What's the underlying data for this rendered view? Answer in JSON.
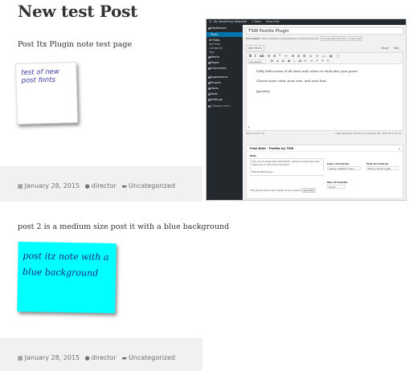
{
  "post1": {
    "title": "New test Post",
    "text": "Post Itx Plugin note test page",
    "note_text": "test of new post fonts",
    "meta": {
      "date": "January 28, 2015",
      "author": "director",
      "category": "Uncategorized"
    }
  },
  "post2": {
    "text": "post 2 is a medium size post it with a blue background",
    "note_text": "post itz note with a blue background",
    "note_color": "#00ffff",
    "meta": {
      "date": "January 28, 2015",
      "author": "director",
      "category": "Uncategorized"
    }
  },
  "wp_screenshot": {
    "adminbar": [
      "My WordPress Website",
      "0",
      "+ New",
      "View Post"
    ],
    "sidebar": {
      "items": [
        {
          "label": "Dashboard",
          "icon": "dashboard-icon"
        },
        {
          "label": "Posts",
          "icon": "posts-icon",
          "active": true
        },
        {
          "label": "Media",
          "icon": "media-icon"
        },
        {
          "label": "Pages",
          "icon": "pages-icon"
        },
        {
          "label": "Comments",
          "icon": "comments-icon"
        },
        {
          "label": "Appearance",
          "icon": "appearance-icon"
        },
        {
          "label": "Plugins",
          "icon": "plugins-icon"
        },
        {
          "label": "Users",
          "icon": "users-icon"
        },
        {
          "label": "Tools",
          "icon": "tools-icon"
        },
        {
          "label": "Settings",
          "icon": "settings-icon"
        },
        {
          "label": "Collapse menu",
          "icon": "collapse-icon"
        }
      ],
      "sub_items": [
        "All Posts",
        "Add New",
        "Categories",
        "Tags"
      ]
    },
    "post_title": "TSW Postitz Plugin",
    "permalink_label": "Permalink:",
    "permalink_url": "http://tswests.createwebsite.com/plugin/?p=42",
    "change_permalinks": "Change Permalinks",
    "view_post": "View Post",
    "add_media": "Add Media",
    "tab_visual": "Visual",
    "tab_text": "Text",
    "paragraph_select": "Paragraph",
    "editor_lines": [
      "Nifty little notes of all sizes and colors to stick into your posts.",
      "Choose your color, your size, and your font.",
      "[postitz]"
    ],
    "path_label": "p",
    "word_count": "Word count: 22",
    "last_edited": "Last edited by director on January 28, 2015 at 9:12 am",
    "metabox_title": "Post Note - Postitz by TSW",
    "note_label": "Note",
    "note_text": "This one is large size (standard), using a script type font. There are 5 cool fonts included.",
    "note_title_value": "TSW Postitz Plugin",
    "color_label": "Color of Post-its",
    "color_value": "yellow (default color)",
    "font_label": "Font for Post-its",
    "font_value": "Henny Script Light",
    "size_label": "Size of Post-its",
    "size_value": "Small",
    "shortcode_note": "The shortcode to add inside of your post is",
    "shortcode_value": "[postitz]"
  }
}
